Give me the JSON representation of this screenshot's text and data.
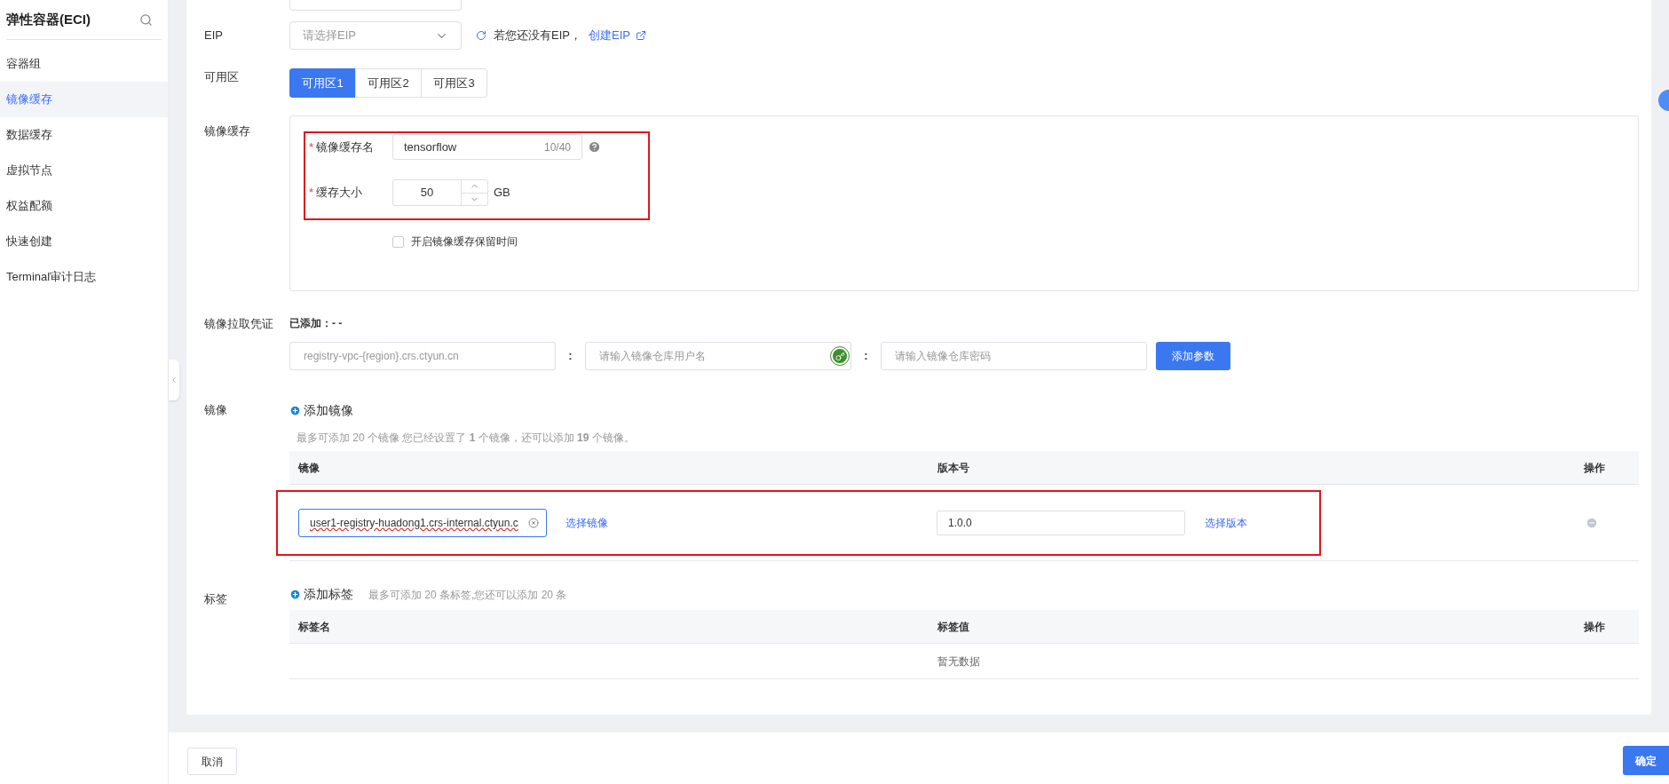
{
  "sidebar": {
    "title": "弹性容器(ECI)",
    "items": [
      {
        "label": "容器组",
        "selected": false
      },
      {
        "label": "镜像缓存",
        "selected": true
      },
      {
        "label": "数据缓存",
        "selected": false
      },
      {
        "label": "虚拟节点",
        "selected": false
      },
      {
        "label": "权益配额",
        "selected": false
      },
      {
        "label": "快速创建",
        "selected": false
      },
      {
        "label": "Terminal审计日志",
        "selected": false
      }
    ]
  },
  "eip": {
    "label": "EIP",
    "placeholder": "请选择EIP",
    "note": "若您还没有EIP，",
    "link": "创建EIP"
  },
  "zone": {
    "label": "可用区",
    "options": [
      {
        "label": "可用区1",
        "selected": true
      },
      {
        "label": "可用区2",
        "selected": false
      },
      {
        "label": "可用区3",
        "selected": false
      }
    ]
  },
  "image_cache": {
    "label": "镜像缓存",
    "name_field": {
      "required_mark": "*",
      "label": "镜像缓存名",
      "value": "tensorflow",
      "counter": "10/40"
    },
    "size_field": {
      "required_mark": "*",
      "label": "缓存大小",
      "value": "50",
      "unit": "GB"
    },
    "retention": {
      "label": "开启镜像缓存保留时间",
      "checked": false
    }
  },
  "credentials": {
    "label": "镜像拉取凭证",
    "added": "已添加：- -",
    "registry_placeholder": "registry-vpc-{region}.crs.ctyun.cn",
    "separator_1": ":",
    "username_placeholder": "请输入镜像仓库用户名",
    "separator_2": ":",
    "password_placeholder": "请输入镜像仓库密码",
    "button": "添加参数"
  },
  "images": {
    "label": "镜像",
    "add": "添加镜像",
    "hint": "最多可添加 20 个镜像 您已经设置了 **1** 个镜像，还可以添加 **19** 个镜像。",
    "columns": [
      "镜像",
      "版本号",
      "操作"
    ],
    "rows": [
      {
        "image": "user1-registry-huadong1.crs-internal.ctyun.c",
        "image_focused": true,
        "select_image": "选择镜像",
        "version": "1.0.0",
        "select_version": "选择版本"
      }
    ]
  },
  "tags": {
    "label": "标签",
    "add": "添加标签",
    "hint": "最多可添加 20 条标签,您还可以添加 20 条",
    "columns": [
      "标签名",
      "标签值",
      "操作"
    ],
    "empty": "暂无数据"
  },
  "footer": {
    "cancel": "取消",
    "confirm": "确定"
  }
}
